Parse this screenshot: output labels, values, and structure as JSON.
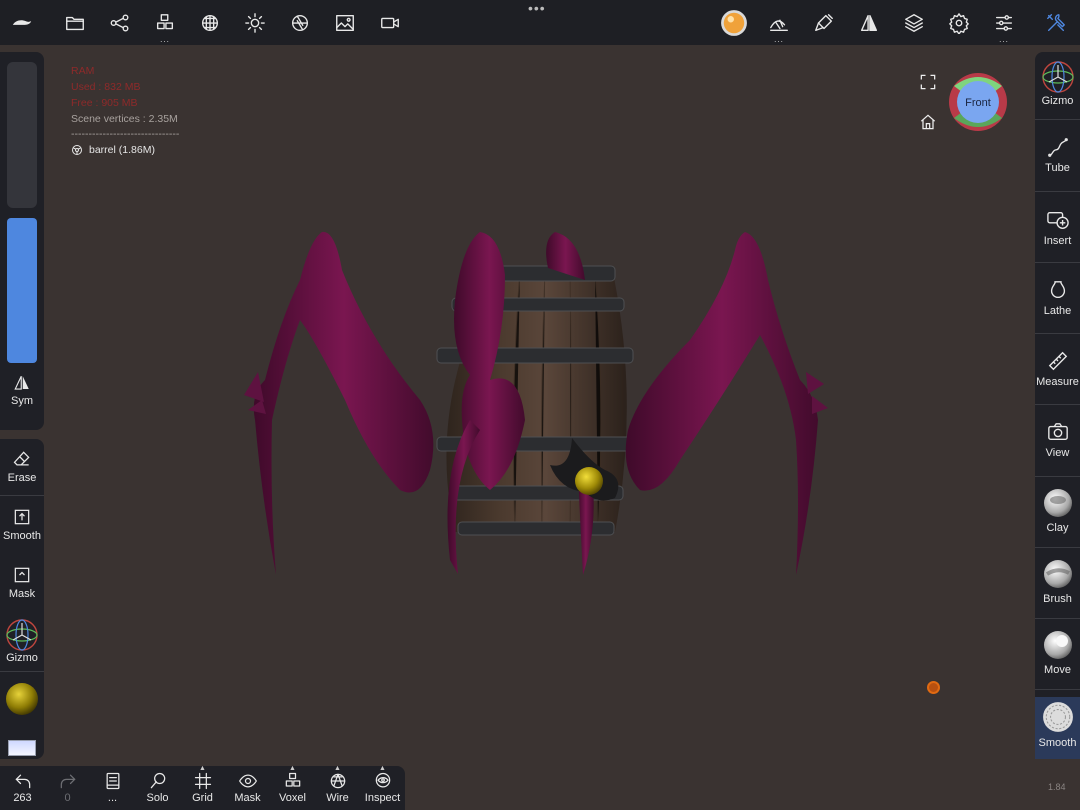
{
  "topbar": {
    "handle": "•••",
    "more": "..."
  },
  "stats": {
    "ram": "RAM",
    "used": "Used : 832 MB",
    "free": "Free : 905 MB",
    "vertices": "Scene vertices : 2.35M",
    "separator": "-------------------------------",
    "object": "barrel (1.86M)"
  },
  "gizmo": {
    "face": "Front"
  },
  "left": {
    "sym": "Sym",
    "erase": "Erase",
    "smooth": "Smooth",
    "mask": "Mask",
    "gizmo": "Gizmo"
  },
  "right": {
    "gizmo": "Gizmo",
    "tube": "Tube",
    "insert": "Insert",
    "lathe": "Lathe",
    "measure": "Measure",
    "view": "View",
    "clay": "Clay",
    "brush": "Brush",
    "move": "Move",
    "smooth": "Smooth"
  },
  "bottom": {
    "undo_count": "263",
    "redo_count": "0",
    "more": "...",
    "solo": "Solo",
    "grid": "Grid",
    "mask": "Mask",
    "voxel": "Voxel",
    "wire": "Wire",
    "inspect": "Inspect"
  },
  "version": "1.84",
  "colors": {
    "background": "#3a3331",
    "panel": "#1f2026",
    "accent": "#4e87df",
    "stats_red": "#8e2a2a",
    "creature": "#5a0f3a",
    "material_yellow": "#c9b400"
  }
}
